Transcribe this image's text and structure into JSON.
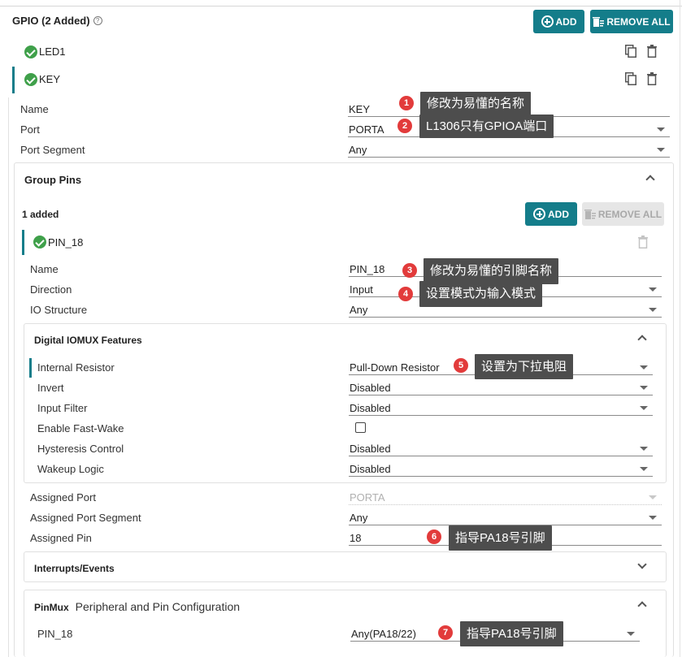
{
  "gpio": {
    "title": "GPIO (2 Added)",
    "help": "?",
    "add_label": "ADD",
    "remove_all_label": "REMOVE ALL",
    "instances": [
      {
        "label": "LED1"
      },
      {
        "label": "KEY"
      }
    ],
    "fields": {
      "name_label": "Name",
      "name_value": "KEY",
      "port_label": "Port",
      "port_value": "PORTA",
      "port_segment_label": "Port Segment",
      "port_segment_value": "Any"
    }
  },
  "group_pins": {
    "title": "Group Pins",
    "count_label": "1 added",
    "add_label": "ADD",
    "remove_all_label": "REMOVE ALL",
    "pin_label": "PIN_18",
    "fields": {
      "name_label": "Name",
      "name_value": "PIN_18",
      "direction_label": "Direction",
      "direction_value": "Input",
      "io_structure_label": "IO Structure",
      "io_structure_value": "Any"
    },
    "iomux": {
      "title": "Digital IOMUX Features",
      "internal_resistor_label": "Internal Resistor",
      "internal_resistor_value": "Pull-Down Resistor",
      "invert_label": "Invert",
      "invert_value": "Disabled",
      "input_filter_label": "Input Filter",
      "input_filter_value": "Disabled",
      "fast_wake_label": "Enable Fast-Wake",
      "fast_wake_checked": false,
      "hysteresis_label": "Hysteresis Control",
      "hysteresis_value": "Disabled",
      "wakeup_label": "Wakeup Logic",
      "wakeup_value": "Disabled"
    },
    "assigned": {
      "port_label": "Assigned Port",
      "port_value": "PORTA",
      "segment_label": "Assigned Port Segment",
      "segment_value": "Any",
      "pin_label": "Assigned Pin",
      "pin_value": "18"
    },
    "interrupts_title": "Interrupts/Events"
  },
  "pinmux": {
    "title_bold": "PinMux",
    "title_rest": "Peripheral and Pin Configuration",
    "pin_label": "PIN_18",
    "pin_value": "Any(PA18/22)"
  },
  "annotations": [
    {
      "num": "1",
      "text": "修改为易懂的名称"
    },
    {
      "num": "2",
      "text": "L1306只有GPIOA端口"
    },
    {
      "num": "3",
      "text": "修改为易懂的引脚名称"
    },
    {
      "num": "4",
      "text": "设置模式为输入模式"
    },
    {
      "num": "5",
      "text": "设置为下拉电阻"
    },
    {
      "num": "6",
      "text": "指导PA18号引脚"
    },
    {
      "num": "7",
      "text": "指导PA18号引脚"
    }
  ],
  "colors": {
    "accent": "#147d8a",
    "ok": "#3fa04a",
    "badge": "#e23b3b",
    "tooltip": "#4d4d4d"
  }
}
